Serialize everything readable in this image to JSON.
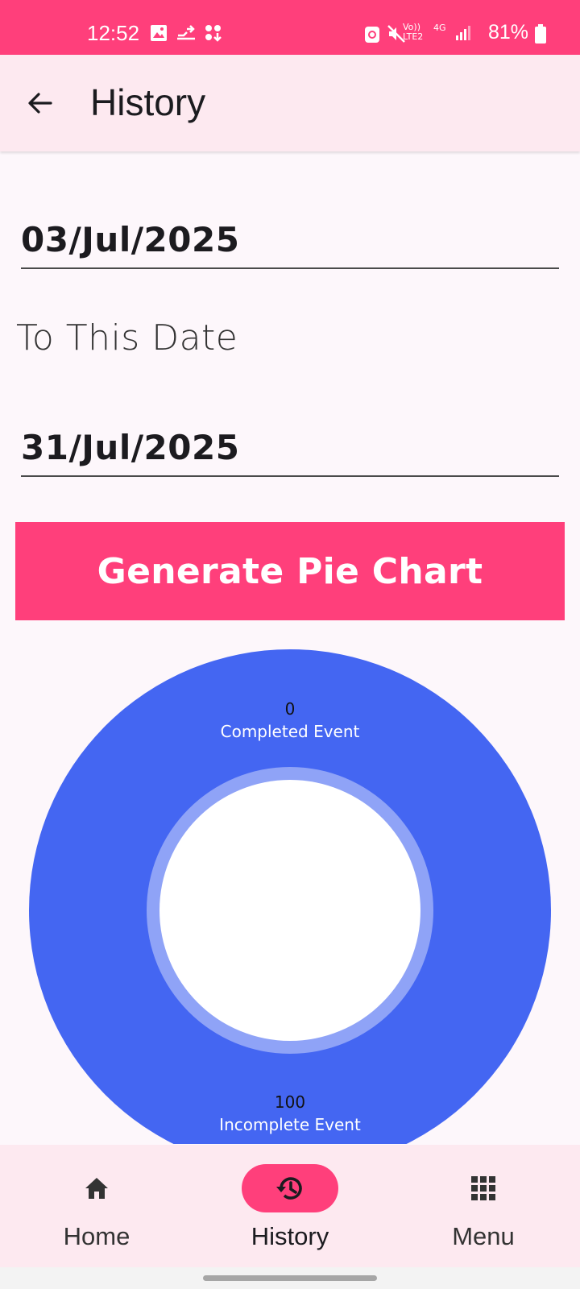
{
  "status_bar": {
    "time": "12:52",
    "battery": "81%",
    "network_labels": {
      "volte": "Vo))",
      "lte": "LTE2",
      "gen": "4G"
    }
  },
  "app_bar": {
    "title": "History"
  },
  "form": {
    "from_date": "03/Jul/2025",
    "to_label": "To This Date",
    "to_date": "31/Jul/2025",
    "generate_button": "Generate Pie Chart"
  },
  "chart_data": {
    "type": "pie",
    "donut": true,
    "slices": [
      {
        "label": "Completed Event",
        "value": 0,
        "value_label": "0",
        "color": "#4466f2"
      },
      {
        "label": "Incomplete Event",
        "value": 100,
        "value_label": "100",
        "color": "#4466f2"
      }
    ]
  },
  "bottom_nav": {
    "items": [
      {
        "label": "Home",
        "icon": "home-icon",
        "active": false
      },
      {
        "label": "History",
        "icon": "history-icon",
        "active": true
      },
      {
        "label": "Menu",
        "icon": "grid-menu-icon",
        "active": false
      }
    ]
  },
  "colors": {
    "accent": "#ff3f7b",
    "chart_blue": "#4466f2",
    "app_bar_bg": "#fde9f0"
  }
}
